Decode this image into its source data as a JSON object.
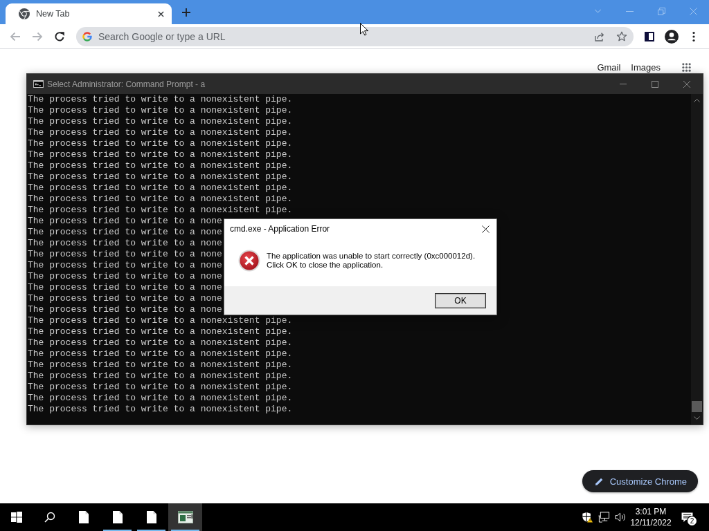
{
  "browser": {
    "tabs": [
      {
        "label": "New Tab",
        "selected": true
      }
    ],
    "nav_buttons": [
      {
        "kind": "back",
        "disabled": true
      },
      {
        "kind": "forward",
        "disabled": true
      },
      {
        "kind": "reload",
        "disabled": false
      }
    ],
    "omnibox": {
      "placeholder": "Search Google or type a URL"
    },
    "page": {
      "links": [
        "Gmail",
        "Images"
      ],
      "customize_button": "Customize Chrome"
    }
  },
  "cmd_window": {
    "title": "Select Administrator: Command Prompt - a",
    "lines": [
      "The process tried to write to a nonexistent pipe.",
      "The process tried to write to a nonexistent pipe.",
      "The process tried to write to a nonexistent pipe.",
      "The process tried to write to a nonexistent pipe.",
      "The process tried to write to a nonexistent pipe.",
      "The process tried to write to a nonexistent pipe.",
      "The process tried to write to a nonexistent pipe.",
      "The process tried to write to a nonexistent pipe.",
      "The process tried to write to a nonexistent pipe.",
      "The process tried to write to a nonexistent pipe.",
      "The process tried to write to a nonexistent pipe.",
      "The process tried to write to a none",
      "The process tried to write to a none",
      "The process tried to write to a none",
      "The process tried to write to a none",
      "The process tried to write to a none",
      "The process tried to write to a none",
      "The process tried to write to a none",
      "The process tried to write to a none",
      "The process tried to write to a none",
      "The process tried to write to a nonexistent pipe.",
      "The process tried to write to a nonexistent pipe.",
      "The process tried to write to a nonexistent pipe.",
      "The process tried to write to a nonexistent pipe.",
      "The process tried to write to a nonexistent pipe.",
      "The process tried to write to a nonexistent pipe.",
      "The process tried to write to a nonexistent pipe.",
      "The process tried to write to a nonexistent pipe.",
      "The process tried to write to a nonexistent pipe."
    ]
  },
  "error_dialog": {
    "title": "cmd.exe - Application Error",
    "message": [
      "The application was unable to start correctly (0xc000012d).",
      "Click OK to close the application."
    ],
    "buttons": [
      "OK"
    ]
  },
  "taskbar": {
    "apps": [
      {
        "kind": "document",
        "running": false,
        "selected": false
      },
      {
        "kind": "document",
        "running": true,
        "selected": false
      },
      {
        "kind": "document",
        "running": true,
        "selected": false
      },
      {
        "kind": "console",
        "running": true,
        "selected": true
      }
    ],
    "clock": {
      "time": "3:01 PM",
      "date": "12/11/2022"
    },
    "notifications": {
      "count": "2"
    }
  }
}
